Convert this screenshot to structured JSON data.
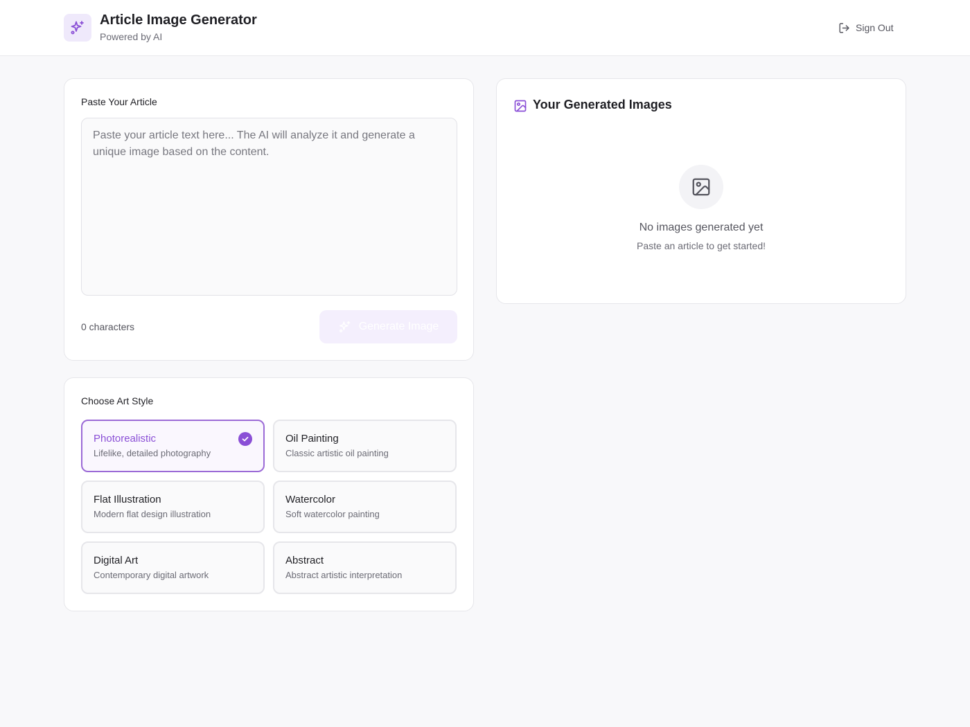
{
  "header": {
    "title": "Article Image Generator",
    "subtitle": "Powered by AI",
    "logo_icon": "sparkles-icon",
    "sign_out_label": "Sign Out",
    "sign_out_icon": "log-out-icon"
  },
  "article": {
    "label": "Paste Your Article",
    "placeholder": "Paste your article text here... The AI will analyze it and generate a unique image based on the content.",
    "value": "",
    "char_count": "0 characters",
    "generate_label": "Generate Image",
    "generate_icon": "sparkles-icon",
    "generate_disabled": true
  },
  "art_style": {
    "label": "Choose Art Style",
    "selected": "Photorealistic",
    "options": [
      {
        "name": "Photorealistic",
        "description": "Lifelike, detailed photography"
      },
      {
        "name": "Oil Painting",
        "description": "Classic artistic oil painting"
      },
      {
        "name": "Flat Illustration",
        "description": "Modern flat design illustration"
      },
      {
        "name": "Watercolor",
        "description": "Soft watercolor painting"
      },
      {
        "name": "Digital Art",
        "description": "Contemporary digital artwork"
      },
      {
        "name": "Abstract",
        "description": "Abstract artistic interpretation"
      }
    ]
  },
  "results": {
    "title": "Your Generated Images",
    "title_icon": "image-icon",
    "empty_icon": "image-icon",
    "empty_title": "No images generated yet",
    "empty_subtitle": "Paste an article to get started!"
  },
  "colors": {
    "accent": "#8a4fd6",
    "accent_light": "#efe9fb",
    "background": "#f8f8fa",
    "card": "#ffffff",
    "border": "#e6e6ea"
  }
}
